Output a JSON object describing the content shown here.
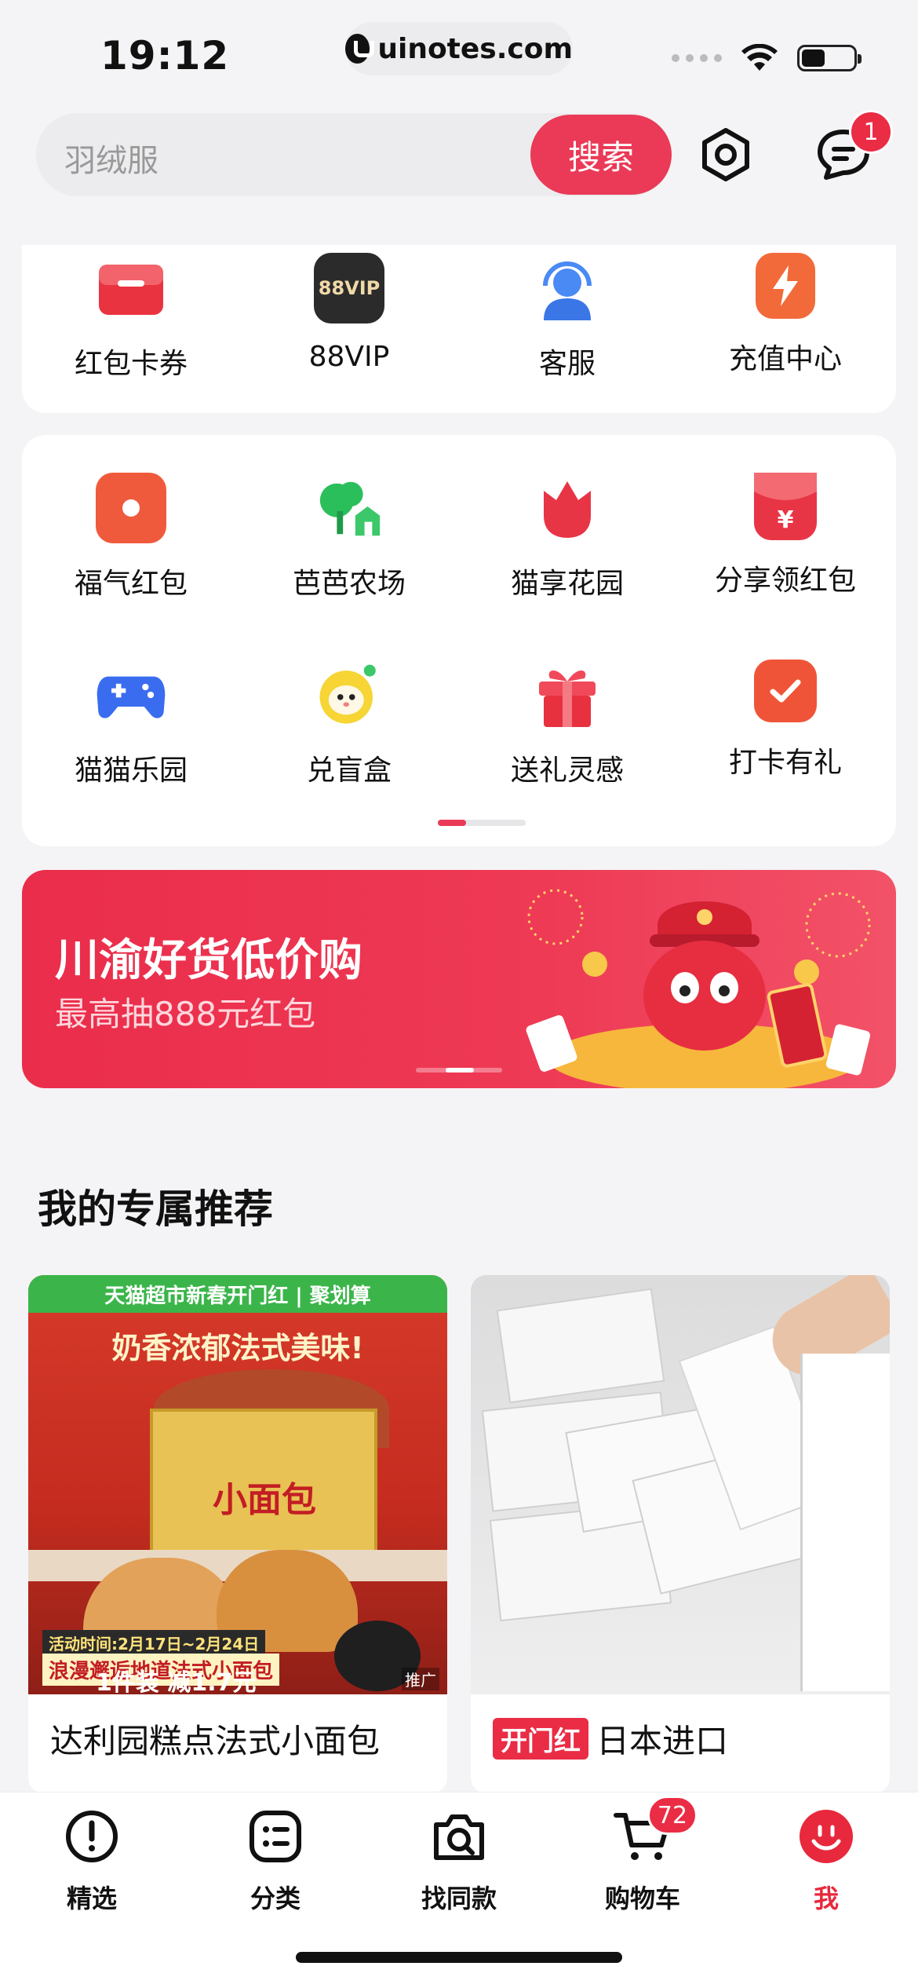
{
  "status_bar": {
    "time": "19:12",
    "url": "uinotes.com",
    "battery_level": 0.45
  },
  "search": {
    "placeholder": "羽绒服",
    "button_label": "搜索"
  },
  "header": {
    "message_badge": "1"
  },
  "quick_row": [
    {
      "label": "红包卡券",
      "icon": "red-envelope-card-icon"
    },
    {
      "label": "88VIP",
      "icon": "88vip-icon",
      "icon_text": "88VIP"
    },
    {
      "label": "客服",
      "icon": "customer-service-icon"
    },
    {
      "label": "充值中心",
      "icon": "recharge-lightning-icon"
    }
  ],
  "apps_grid": [
    {
      "label": "福气红包",
      "icon": "lucky-red-packet-icon"
    },
    {
      "label": "芭芭农场",
      "icon": "baba-farm-icon"
    },
    {
      "label": "猫享花园",
      "icon": "tulip-garden-icon"
    },
    {
      "label": "分享领红包",
      "icon": "share-red-packet-icon"
    },
    {
      "label": "猫猫乐园",
      "icon": "gamepad-icon"
    },
    {
      "label": "兑盲盒",
      "icon": "blind-box-icon"
    },
    {
      "label": "送礼灵感",
      "icon": "gift-icon"
    },
    {
      "label": "打卡有礼",
      "icon": "check-in-icon"
    }
  ],
  "banner": {
    "title": "川渝好货低价购",
    "subtitle": "最高抽888元红包"
  },
  "recommend": {
    "title": "我的专属推荐",
    "products": [
      {
        "name": "达利园糕点法式小面包",
        "img_top": "天猫超市新春开门红 | 聚划算",
        "img_slogan": "奶香浓郁法式美味!",
        "img_box": "小面包",
        "img_activity": "活动时间:2月17日~2月24日",
        "img_line": "浪漫邂逅地道法式小面包",
        "img_promo": "1件装 减1.7元",
        "img_ad": "推广"
      },
      {
        "tag": "开门红",
        "name": "日本进口"
      }
    ]
  },
  "tabs": [
    {
      "label": "精选",
      "icon": "home-compass-icon"
    },
    {
      "label": "分类",
      "icon": "category-icon"
    },
    {
      "label": "找同款",
      "icon": "search-camera-icon"
    },
    {
      "label": "购物车",
      "icon": "cart-icon",
      "badge": "72"
    },
    {
      "label": "我",
      "icon": "profile-icon",
      "active": true
    }
  ],
  "colors": {
    "accent": "#ea3a57",
    "badge": "#ea2c45",
    "text": "#111111"
  }
}
